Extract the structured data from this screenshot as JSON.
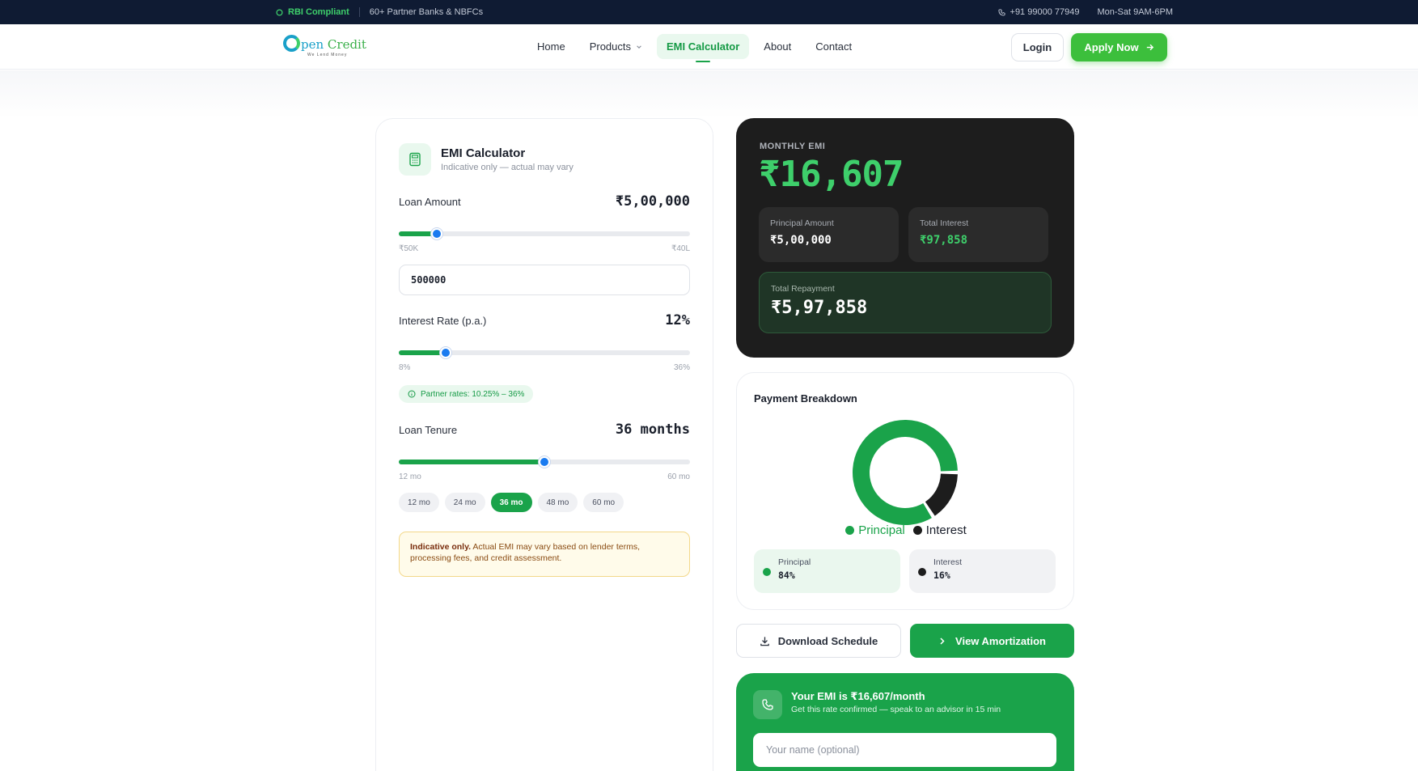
{
  "topbar": {
    "rbi_label": "RBI Compliant",
    "partners_label": "60+ Partner Banks & NBFCs",
    "phone": "+91 99000 77949",
    "hours": "Mon-Sat 9AM-6PM"
  },
  "nav": {
    "logo_tagline": "We Lend Money",
    "items": [
      {
        "label": "Home"
      },
      {
        "label": "Products"
      },
      {
        "label": "EMI Calculator"
      },
      {
        "label": "About"
      },
      {
        "label": "Contact"
      }
    ],
    "login_label": "Login",
    "apply_label": "Apply Now"
  },
  "calculator": {
    "title": "EMI Calculator",
    "subtitle": "Indicative only — actual may vary",
    "loan_amount": {
      "label": "Loan Amount",
      "display": "₹5,00,000",
      "min": "₹50K",
      "max": "₹40L",
      "input_value": "500000",
      "slider_percent": 13
    },
    "interest": {
      "label": "Interest Rate (p.a.)",
      "display": "12%",
      "min": "8%",
      "max": "36%",
      "slider_percent": 16,
      "partner_rates": "Partner rates: 10.25% – 36%"
    },
    "tenure": {
      "label": "Loan Tenure",
      "display": "36 months",
      "min": "12 mo",
      "max": "60 mo",
      "slider_percent": 50,
      "chips": [
        "12 mo",
        "24 mo",
        "36 mo",
        "48 mo",
        "60 mo"
      ],
      "selected_chip": "36 mo"
    },
    "note_bold": "Indicative only.",
    "note_text": " Actual EMI may vary based on lender terms, processing fees, and credit assessment."
  },
  "summary": {
    "monthly_label": "MONTHLY EMI",
    "monthly_value": "₹16,607",
    "principal_label": "Principal Amount",
    "principal_value": "₹5,00,000",
    "interest_label": "Total Interest",
    "interest_value": "₹97,858",
    "total_label": "Total Repayment",
    "total_value": "₹5,97,858"
  },
  "breakdown": {
    "title": "Payment Breakdown",
    "legend_principal": "Principal",
    "legend_interest": "Interest",
    "principal_label": "Principal",
    "principal_pct": "84%",
    "interest_label": "Interest",
    "interest_pct": "16%",
    "principal_fraction": 0.84,
    "colors": {
      "principal": "#1aa34a",
      "interest": "#1d1d1d"
    }
  },
  "actions": {
    "download_label": "Download Schedule",
    "amortization_label": "View Amortization"
  },
  "cta": {
    "title": "Your EMI is ₹16,607/month",
    "subtitle": "Get this rate confirmed — speak to an advisor in 15 min",
    "name_placeholder": "Your name (optional)"
  }
}
